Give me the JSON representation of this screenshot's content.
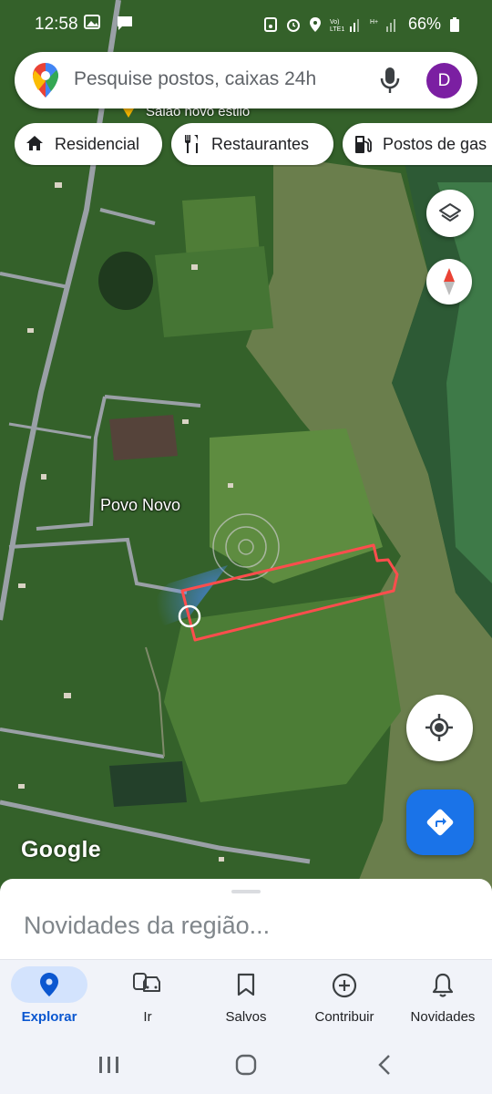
{
  "status_bar": {
    "time": "12:58",
    "battery": "66%",
    "icons": [
      "image-icon",
      "message-icon",
      "save-icon",
      "alarm-icon",
      "location-icon",
      "volte-signal-icon",
      "hplus-signal-icon",
      "battery-icon"
    ]
  },
  "search": {
    "placeholder": "Pesquise postos, caixas 24h",
    "avatar_letter": "D",
    "avatar_color": "#7b1fa2"
  },
  "chips": [
    {
      "label": "Residencial",
      "icon": "home-icon"
    },
    {
      "label": "Restaurantes",
      "icon": "restaurant-icon"
    },
    {
      "label": "Postos de gas",
      "icon": "gas-station-icon"
    }
  ],
  "map": {
    "place_label": "Povo Novo",
    "poi_label": "Salão novo estilo",
    "attribution": "Google",
    "boundary_color": "#ff4d4d"
  },
  "sheet": {
    "title": "Novidades da região..."
  },
  "bottom_nav": [
    {
      "label": "Explorar",
      "icon": "explore-pin-icon",
      "active": true
    },
    {
      "label": "Ir",
      "icon": "car-transit-icon",
      "active": false
    },
    {
      "label": "Salvos",
      "icon": "bookmark-icon",
      "active": false
    },
    {
      "label": "Contribuir",
      "icon": "add-circle-icon",
      "active": false
    },
    {
      "label": "Novidades",
      "icon": "bell-icon",
      "active": false
    }
  ],
  "colors": {
    "accent": "#1a73e8",
    "active_pill": "#d3e3fd"
  }
}
